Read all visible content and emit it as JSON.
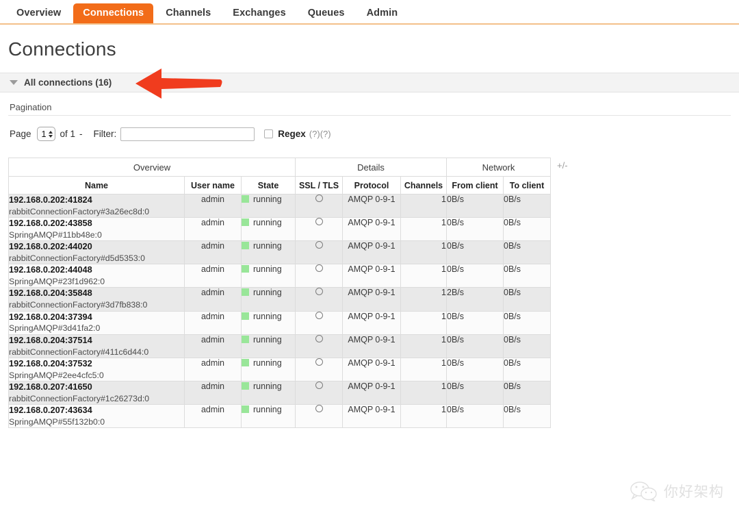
{
  "nav": {
    "items": [
      {
        "label": "Overview",
        "active": false
      },
      {
        "label": "Connections",
        "active": true
      },
      {
        "label": "Channels",
        "active": false
      },
      {
        "label": "Exchanges",
        "active": false
      },
      {
        "label": "Queues",
        "active": false
      },
      {
        "label": "Admin",
        "active": false
      }
    ],
    "accent_color": "#f26c19",
    "rule_color": "#f3c08a"
  },
  "page": {
    "title": "Connections"
  },
  "section": {
    "title": "All connections (16)",
    "expanded": true
  },
  "pagination": {
    "heading": "Pagination",
    "page_word": "Page",
    "page_value": "1",
    "of_text": "of 1",
    "dash": "-",
    "filter_label": "Filter:",
    "filter_value": "",
    "filter_placeholder": "",
    "regex_label": "Regex",
    "regex_checked": false,
    "help_1": "(?)",
    "help_2": "(?)"
  },
  "table": {
    "group_headers": [
      "Overview",
      "Details",
      "Network"
    ],
    "columns": [
      "Name",
      "User name",
      "State",
      "SSL / TLS",
      "Protocol",
      "Channels",
      "From client",
      "To client"
    ],
    "plus_minus": "+/-",
    "state_color": "#99e699",
    "rows": [
      {
        "name": "192.168.0.202:41824",
        "client": "rabbitConnectionFactory#3a26ec8d:0",
        "user": "admin",
        "state": "running",
        "ssl": "",
        "protocol": "AMQP 0-9-1",
        "channels": "1",
        "from_client": "0B/s",
        "to_client": "0B/s"
      },
      {
        "name": "192.168.0.202:43858",
        "client": "SpringAMQP#11bb48e:0",
        "user": "admin",
        "state": "running",
        "ssl": "",
        "protocol": "AMQP 0-9-1",
        "channels": "1",
        "from_client": "0B/s",
        "to_client": "0B/s"
      },
      {
        "name": "192.168.0.202:44020",
        "client": "rabbitConnectionFactory#d5d5353:0",
        "user": "admin",
        "state": "running",
        "ssl": "",
        "protocol": "AMQP 0-9-1",
        "channels": "1",
        "from_client": "0B/s",
        "to_client": "0B/s"
      },
      {
        "name": "192.168.0.202:44048",
        "client": "SpringAMQP#23f1d962:0",
        "user": "admin",
        "state": "running",
        "ssl": "",
        "protocol": "AMQP 0-9-1",
        "channels": "1",
        "from_client": "0B/s",
        "to_client": "0B/s"
      },
      {
        "name": "192.168.0.204:35848",
        "client": "rabbitConnectionFactory#3d7fb838:0",
        "user": "admin",
        "state": "running",
        "ssl": "",
        "protocol": "AMQP 0-9-1",
        "channels": "1",
        "from_client": "2B/s",
        "to_client": "0B/s"
      },
      {
        "name": "192.168.0.204:37394",
        "client": "SpringAMQP#3d41fa2:0",
        "user": "admin",
        "state": "running",
        "ssl": "",
        "protocol": "AMQP 0-9-1",
        "channels": "1",
        "from_client": "0B/s",
        "to_client": "0B/s"
      },
      {
        "name": "192.168.0.204:37514",
        "client": "rabbitConnectionFactory#411c6d44:0",
        "user": "admin",
        "state": "running",
        "ssl": "",
        "protocol": "AMQP 0-9-1",
        "channels": "1",
        "from_client": "0B/s",
        "to_client": "0B/s"
      },
      {
        "name": "192.168.0.204:37532",
        "client": "SpringAMQP#2ee4cfc5:0",
        "user": "admin",
        "state": "running",
        "ssl": "",
        "protocol": "AMQP 0-9-1",
        "channels": "1",
        "from_client": "0B/s",
        "to_client": "0B/s"
      },
      {
        "name": "192.168.0.207:41650",
        "client": "rabbitConnectionFactory#1c26273d:0",
        "user": "admin",
        "state": "running",
        "ssl": "",
        "protocol": "AMQP 0-9-1",
        "channels": "1",
        "from_client": "0B/s",
        "to_client": "0B/s"
      },
      {
        "name": "192.168.0.207:43634",
        "client": "SpringAMQP#55f132b0:0",
        "user": "admin",
        "state": "running",
        "ssl": "",
        "protocol": "AMQP 0-9-1",
        "channels": "1",
        "from_client": "0B/s",
        "to_client": "0B/s"
      }
    ]
  },
  "annotation": {
    "arrow_color": "#f03c1e",
    "direction": "left"
  },
  "watermark": {
    "text": "你好架构"
  }
}
